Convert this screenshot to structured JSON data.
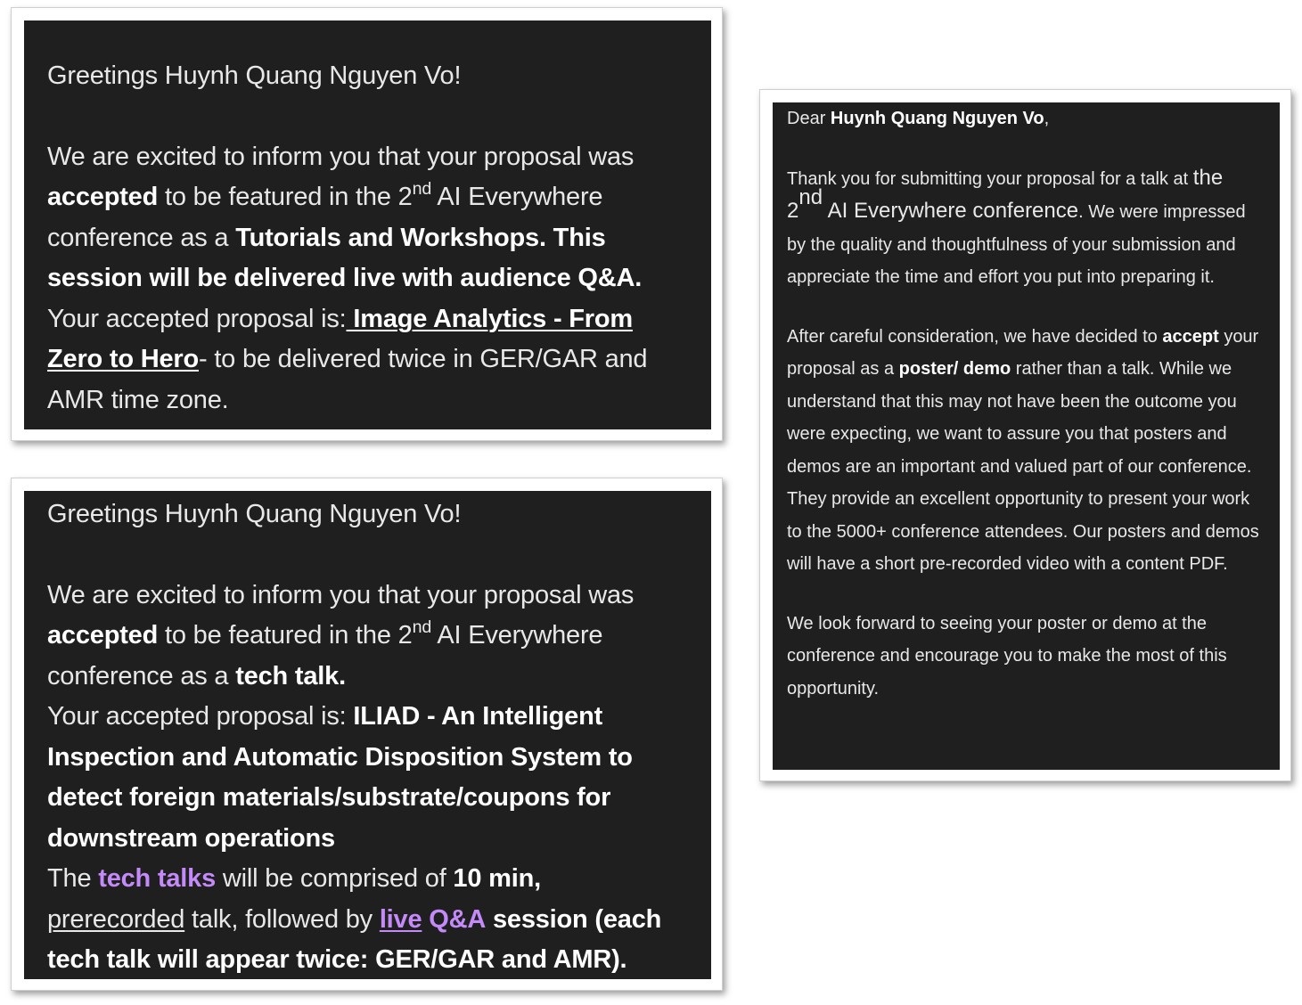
{
  "email_tutorial": {
    "greeting": "Greetings Huynh Quang Nguyen Vo!",
    "intro": "We are excited to inform you that your proposal was",
    "accepted": "accepted",
    "featured": "to be featured in the 2",
    "ordinal": "nd",
    "conference": "AI Everywhere",
    "as_a": "conference as a",
    "session_type": "Tutorials and Workshops. This session will be delivered live with audience Q&A.",
    "proposal_label": "Your accepted proposal is:",
    "proposal_title": " Image Analytics - From Zero to Hero",
    "delivery": "- to be delivered twice in GER/GAR and AMR time zone."
  },
  "email_tech_talk": {
    "greeting": "Greetings Huynh Quang Nguyen Vo!",
    "intro": "We are excited to inform you that your proposal was",
    "accepted": "accepted",
    "featured": "to be featured in the 2",
    "ordinal": "nd",
    "conference": "AI Everywhere",
    "as_a": "conference as a",
    "session_type": "tech talk.",
    "proposal_label": "Your accepted proposal is:",
    "proposal_title": "ILIAD - An Intelligent Inspection and Automatic Disposition System to detect foreign materials/substrate/coupons for downstream operations",
    "the": "The",
    "tech_talks": "tech talks",
    "comprised": "will be comprised of",
    "duration": "10 min,",
    "prerecorded": "prerecorded",
    "followed_by": "talk, followed by",
    "live": "live",
    "qa": "Q&A",
    "session_note": "session (each tech talk will appear twice: GER/GAR and AMR)."
  },
  "email_poster": {
    "dear": "Dear",
    "name": "Huynh Quang Nguyen Vo",
    "comma": ",",
    "thanks": "Thank you for submitting your proposal for a talk at",
    "the": "the",
    "ordinal_prefix": "2",
    "ordinal": "nd",
    "conference": "AI Everywhere conference",
    "impressed": ". We were impressed by the quality and thoughtfulness of your submission and appreciate the time and effort you put into preparing it.",
    "decided": "After careful consideration, we have decided to",
    "accept": "accept",
    "your_proposal_as_a": "your proposal as a",
    "poster_demo": "poster/ demo",
    "rather": "rather than a talk. While we understand that this may not have been the outcome you were expecting, we want to assure you that posters and demos are an important and valued part of our conference. They provide an excellent opportunity to present your work to the 5000+ conference attendees. Our posters and demos will have a short pre-recorded video with a content PDF.",
    "closing": "We look forward to seeing your poster or demo at the conference and encourage you to make the most of this opportunity."
  }
}
